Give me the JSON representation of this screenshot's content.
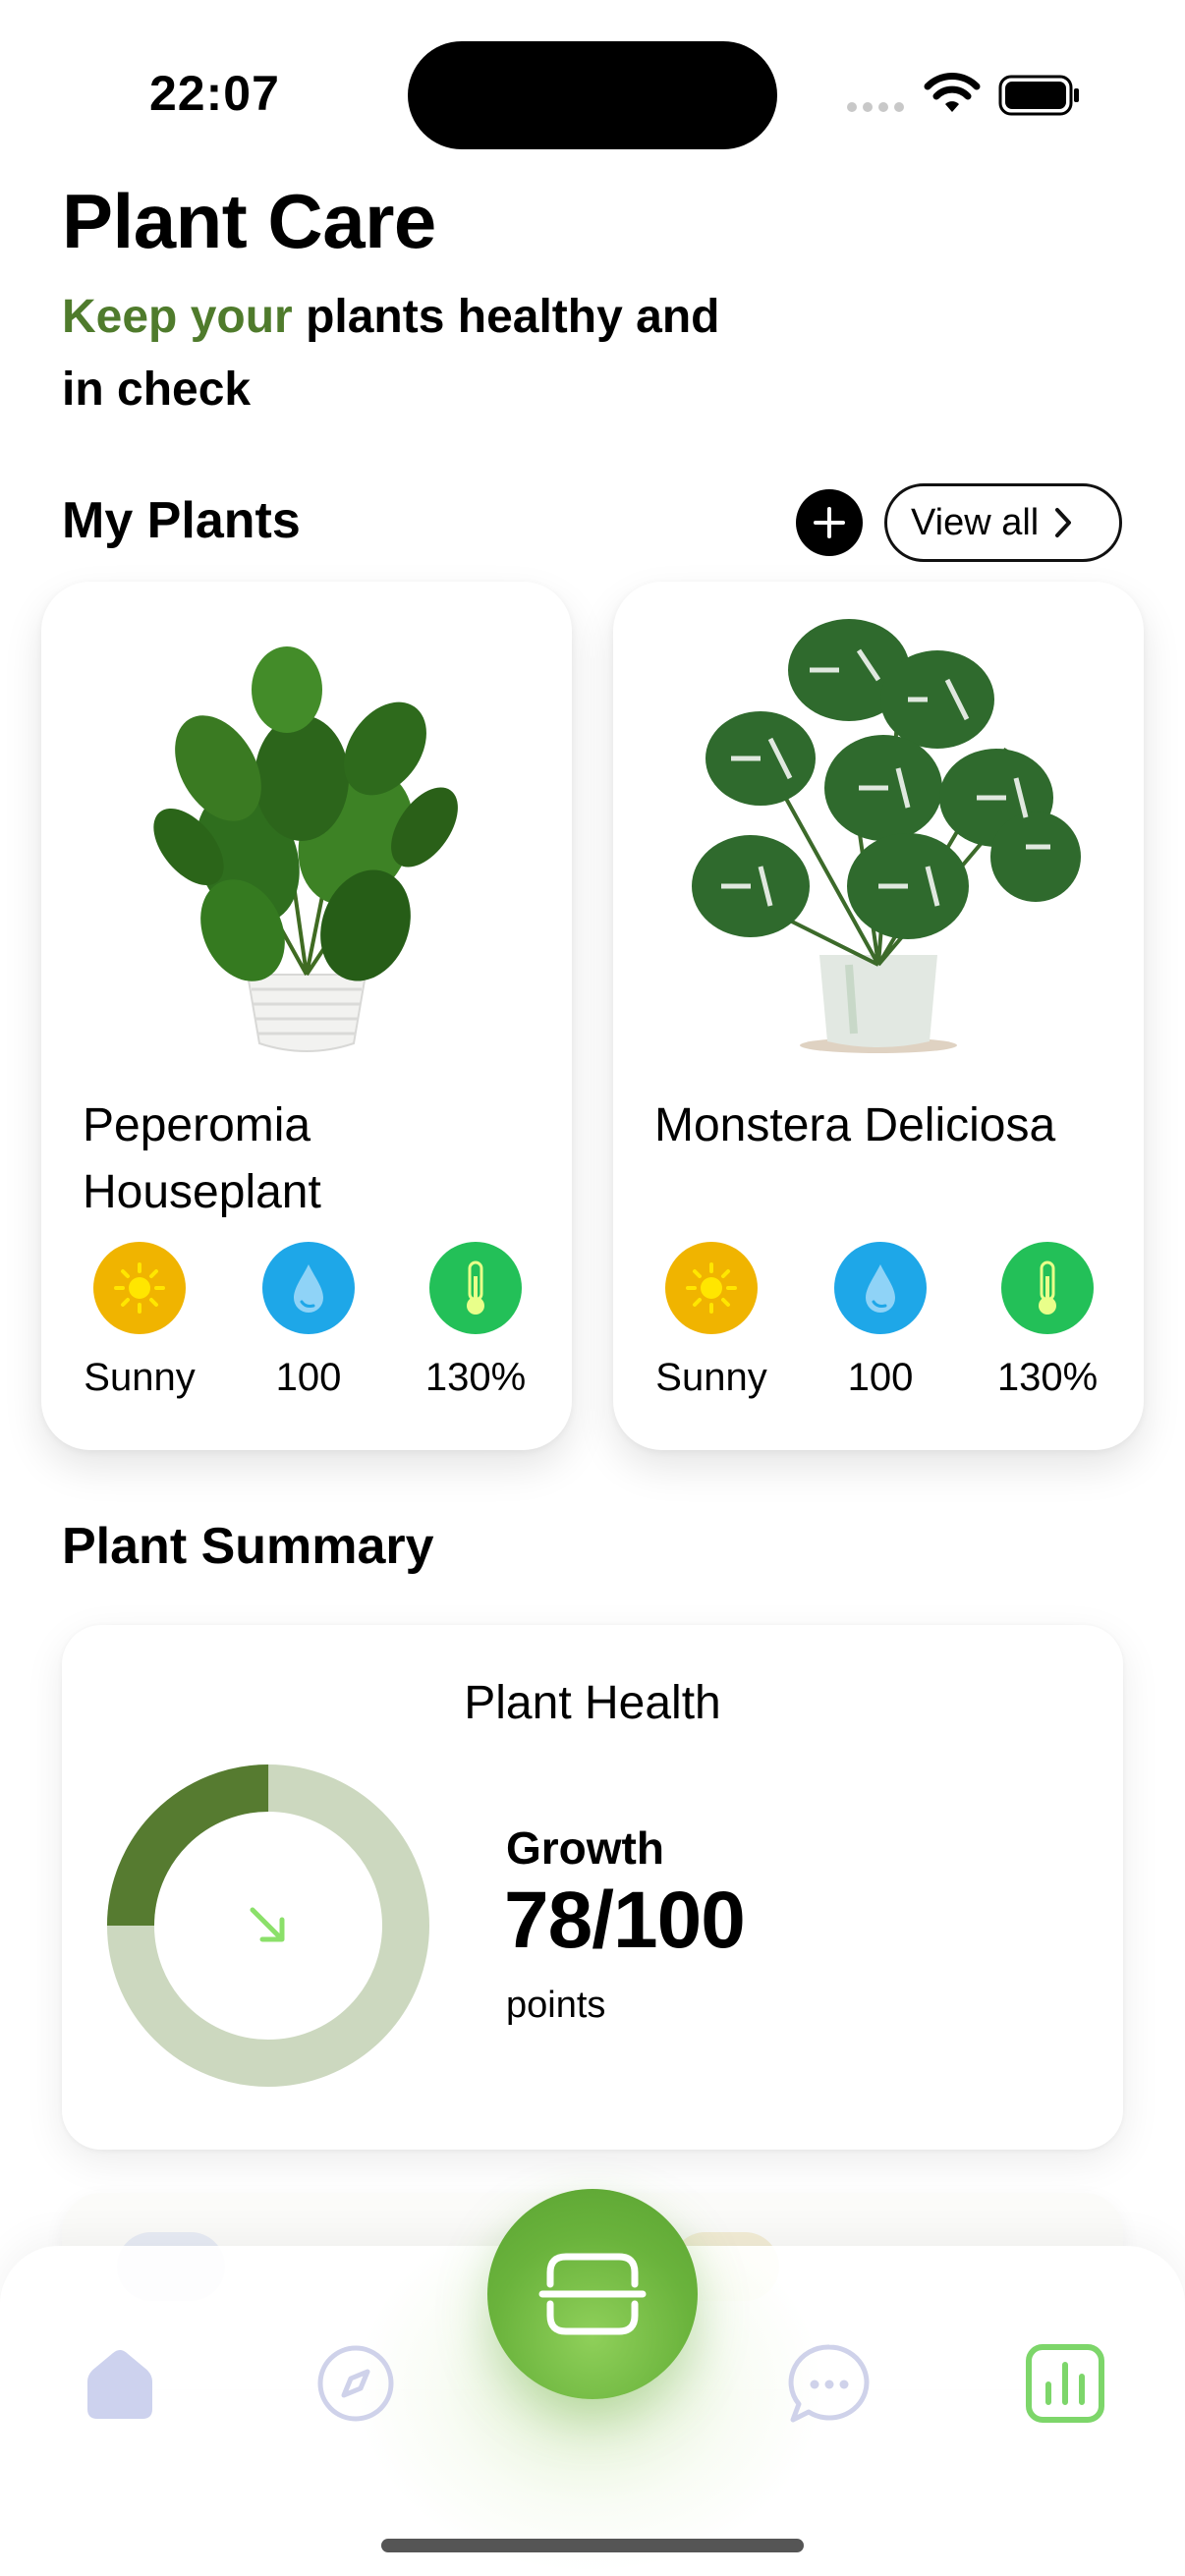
{
  "status_bar": {
    "time": "22:07"
  },
  "header": {
    "title": "Plant Care",
    "subtitle_accent": "Keep your",
    "subtitle_rest": " plants healthy and in check"
  },
  "my_plants": {
    "title": "My Plants",
    "view_all_label": "View all",
    "plants": [
      {
        "name": "Peperomia Houseplant",
        "sun": "Sunny",
        "water": "100",
        "temperature": "130%"
      },
      {
        "name": "Monstera Deliciosa",
        "sun": "Sunny",
        "water": "100",
        "temperature": "130%"
      }
    ]
  },
  "summary": {
    "title": "Plant Summary",
    "card_title": "Plant Health",
    "growth_label": "Growth",
    "growth_value": "78/100",
    "growth_unit": "points",
    "progress_fraction": 0.25
  },
  "colors": {
    "accent": "#4f7b2c",
    "sun": "#f0b400",
    "water": "#1ea7e8",
    "temperature": "#23c058",
    "donut_filled": "#567b30",
    "donut_track": "#ccd8bf",
    "active_nav": "#7dd66a"
  },
  "bottom_nav": {
    "items": [
      "home-icon",
      "compass-icon",
      "scan-icon",
      "chat-icon",
      "stats-icon"
    ]
  }
}
